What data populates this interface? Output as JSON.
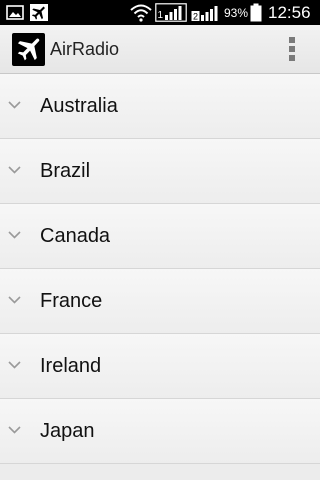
{
  "status_bar": {
    "battery_percent": "93%",
    "clock": "12:56",
    "icons": [
      "gallery-icon",
      "airplane-icon",
      "wifi-icon",
      "signal-icon",
      "signal-icon",
      "battery-icon"
    ]
  },
  "action_bar": {
    "title": "AirRadio",
    "app_icon": "airplane-icon",
    "menu_icon": "overflow-menu-icon"
  },
  "countries": [
    {
      "label": "Australia",
      "icon": "chevron-down-icon"
    },
    {
      "label": "Brazil",
      "icon": "chevron-down-icon"
    },
    {
      "label": "Canada",
      "icon": "chevron-down-icon"
    },
    {
      "label": "France",
      "icon": "chevron-down-icon"
    },
    {
      "label": "Ireland",
      "icon": "chevron-down-icon"
    },
    {
      "label": "Japan",
      "icon": "chevron-down-icon"
    }
  ]
}
